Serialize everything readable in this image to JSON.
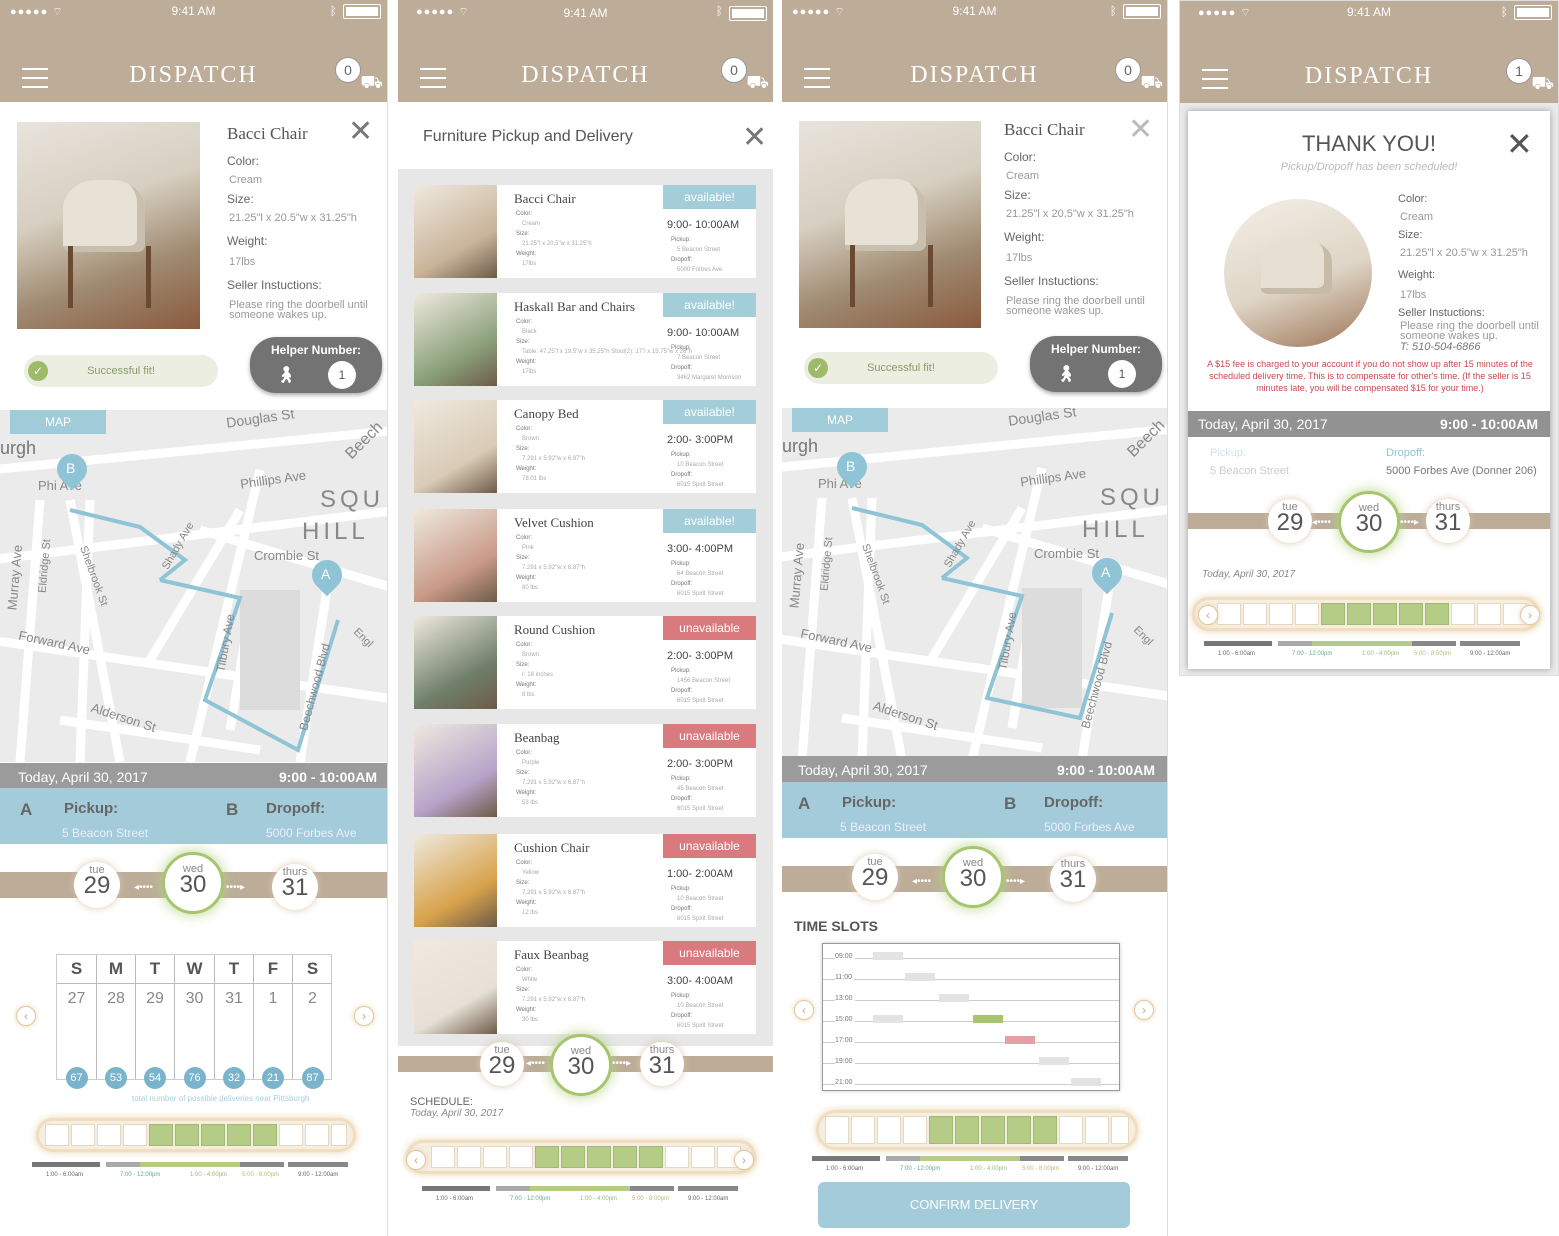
{
  "status": {
    "time": "9:41 AM",
    "signal": "●●●●● ⌔",
    "bluetooth": "ᛒ"
  },
  "header": {
    "title": "DISPATCH",
    "truck": "⛟"
  },
  "s1": {
    "cart": "0",
    "product": {
      "name": "Bacci Chair",
      "color_label": "Color:",
      "color": "Cream",
      "size_label": "Size:",
      "size": "21.25\"l x 20.5\"w x 31.25\"h",
      "weight_label": "Weight:",
      "weight": "17lbs",
      "instr_label": "Seller Instuctions:",
      "instr": "Please ring the doorbell until someone wakes up."
    },
    "fit": "Successful fit!",
    "helper_label": "Helper Number:",
    "helper_num": "1",
    "map_tag": "MAP",
    "date": "Today, April 30, 2017",
    "time_range": "9:00 - 10:00AM",
    "pickup": {
      "letter": "A",
      "label": "Pickup:",
      "addr": "5 Beacon Street"
    },
    "dropoff": {
      "letter": "B",
      "label": "Dropoff:",
      "addr": "5000 Forbes Ave"
    },
    "cal": {
      "heads": [
        "S",
        "M",
        "T",
        "W",
        "T",
        "F",
        "S"
      ],
      "dates": [
        "27",
        "28",
        "29",
        "30",
        "31",
        "1",
        "2"
      ],
      "counts": [
        "67",
        "53",
        "54",
        "76",
        "32",
        "21",
        "87"
      ]
    },
    "note": "total number of possible deliveries near Pittsburgh"
  },
  "days": [
    {
      "name": "tue",
      "num": "29"
    },
    {
      "name": "wed",
      "num": "30"
    },
    {
      "name": "thurs",
      "num": "31"
    }
  ],
  "legend": [
    "1:00 - 6:00am",
    "7:00 - 12:00pm",
    "1:00 - 4:00pm",
    "5:00 - 8:00pm",
    "9:00 - 12:00am"
  ],
  "map_labels": {
    "douglas": "Douglas St",
    "beech": "Beech",
    "phillips1": "Phillips Ave",
    "phillips2": "Phi  Ave",
    "sq": "SQU",
    "hill": "HILL",
    "crombie": "Crombie St",
    "murray": "Murray Ave",
    "eldridge": "Eldridge St",
    "shady": "Shady Ave",
    "shelbrook": "Shelbrook St",
    "forward": "Forward Ave",
    "tilbury": "Tilbury Ave",
    "alderson": "Alderson St",
    "beechwood": "Beechwood Blvd",
    "burgh": "urgh",
    "engl": "Engl",
    "markerA": "A",
    "markerB": "B"
  },
  "s2": {
    "cart": "0",
    "title": "Furniture Pickup and Delivery",
    "schedule": "SCHEDULE:",
    "schedule_date": "Today, April  30, 2017",
    "items": [
      {
        "name": "Bacci Chair",
        "status": "available!",
        "time": "9:00- 10:00AM",
        "color": "Cream",
        "size": "21.25\"l x 20.5\"w x 31.25\"h",
        "weight": "17lbs",
        "pickup": "5 Beacon Street",
        "dropoff": "5000 Forbes Ave"
      },
      {
        "name": "Haskall Bar and Chairs",
        "status": "available!",
        "time": "9:00- 10:00AM",
        "color": "Black",
        "size": "Table: 47.25\"l x 19.5\"w x 35.25\"h Stool(2): 17\"l x 15.75\"w x 26\"h",
        "weight": "17lbs",
        "pickup": "7 Beacon Street",
        "dropoff": "3462 Margaret Morrison"
      },
      {
        "name": "Canopy Bed",
        "status": "available!",
        "time": "2:00- 3:00PM",
        "color": "Brown",
        "size": "7.291 x 5.92\"w x 6.87\"h",
        "weight": "78.01 lbs",
        "pickup": "10 Beacon Street",
        "dropoff": "6015 Spirit Street"
      },
      {
        "name": "Velvet Cushion",
        "status": "available!",
        "time": "3:00- 4:00PM",
        "color": "Pink",
        "size": "7.291 x 5.92\"w x 6.87\"h",
        "weight": "80 lbs",
        "pickup": "64 Beacon Street",
        "dropoff": "6015 Spirit Street"
      },
      {
        "name": "Round Cushion",
        "status": "unavailable",
        "time": "2:00- 3:00PM",
        "color": "Brown",
        "size": "r: 18 inches",
        "weight": "8 lbs",
        "pickup": "1456 Beacon Street",
        "dropoff": "6015 Spirit Street"
      },
      {
        "name": "Beanbag",
        "status": "unavailable",
        "time": "2:00- 3:00PM",
        "color": "Purple",
        "size": "7.291 x 5.92\"w x 6.87\"h",
        "weight": "53 lbs",
        "pickup": "45 Beacon Street",
        "dropoff": "6015 Spirit Street"
      },
      {
        "name": "Cushion Chair",
        "status": "unavailable",
        "time": "1:00- 2:00AM",
        "color": "Yellow",
        "size": "7.291 x 5.92\"w x 6.87\"h",
        "weight": "12 lbs",
        "pickup": "10 Beacon Street",
        "dropoff": "6015 Spirit Street"
      },
      {
        "name": "Faux Beanbag",
        "status": "unavailable",
        "time": "3:00- 4:00AM",
        "color": "White",
        "size": "7.291 x 5.92\"w x 6.87\"h",
        "weight": "30 lbs",
        "pickup": "10 Beacon Street",
        "dropoff": "6015 Spirit Street"
      }
    ],
    "labels": {
      "color": "Color:",
      "size": "Size:",
      "weight": "Weight:",
      "pickup": "Pickup:",
      "dropoff": "Dropoff:"
    }
  },
  "s3": {
    "cart": "0",
    "timeslots_title": "TIME SLOTS",
    "times": [
      "09:00",
      "11:00",
      "13:00",
      "15:00",
      "17:00",
      "19:00",
      "21:00"
    ],
    "confirm": "CONFIRM DELIVERY"
  },
  "s4": {
    "cart": "1",
    "thanks": "THANK YOU!",
    "sub": "Pickup/Dropoff has been scheduled!",
    "phone": "T: 510-504-6866",
    "fee": "A $15 fee is charged to your account if you do not show up after 15 minutes of the scheduled delivery time. This is to compensate for other's time. (If the seller is 15 minutes late, you will be compensated $15 for your time.)",
    "dropoff_addr": "5000 Forbes Ave (Donner 206)",
    "schedule_date": "Today, April  30, 2017"
  }
}
